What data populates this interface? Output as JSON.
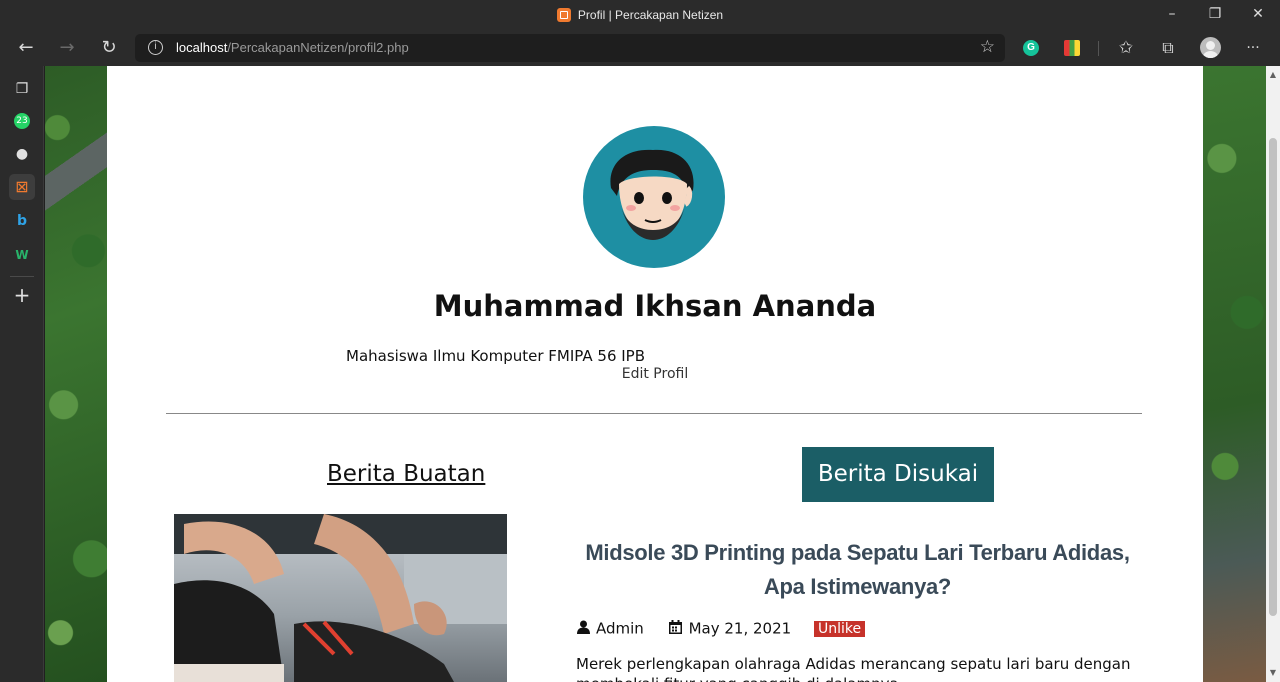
{
  "window": {
    "title": "Profil | Percakapan Netizen",
    "minimize_glyph": "–",
    "restore_glyph": "❐",
    "close_glyph": "✕"
  },
  "toolbar": {
    "back_glyph": "←",
    "forward_glyph": "→",
    "refresh_glyph": "↻",
    "address_host": "localhost",
    "address_path": "/PercakapanNetizen/profil2.php",
    "info_glyph": "i",
    "favorite_glyph": "☆",
    "grammarly_label": "G",
    "favorites_glyph": "✩",
    "collections_glyph": "⧉",
    "more_glyph": "···"
  },
  "sidebar": {
    "items": [
      {
        "name": "tabs-icon",
        "glyph": "❐"
      },
      {
        "name": "whatsapp-icon",
        "glyph": "23"
      },
      {
        "name": "github-icon",
        "glyph": "●"
      },
      {
        "name": "xampp-icon",
        "glyph": "⊠"
      },
      {
        "name": "bing-icon",
        "glyph": "b"
      },
      {
        "name": "w-icon",
        "glyph": "W"
      }
    ],
    "add_glyph": "+"
  },
  "profile": {
    "name": "Muhammad Ikhsan Ananda",
    "bio": "Mahasiswa Ilmu Komputer FMIPA 56 IPB",
    "edit_label": "Edit Profil"
  },
  "sections": {
    "created_label": "Berita Buatan",
    "liked_label": "Berita Disukai"
  },
  "article": {
    "title": "Midsole 3D Printing pada Sepatu Lari Terbaru Adidas, Apa Istimewanya?",
    "author": "Admin",
    "date": "May 21, 2021",
    "unlike_label": "Unlike",
    "excerpt": "Merek perlengkapan olahraga Adidas merancang sepatu lari baru dengan membekali fitur yang canggih di dalamnya."
  },
  "colors": {
    "accent_teal": "#1b5e66",
    "avatar_bg": "#1e8fa3",
    "unlike_red": "#c6322a",
    "title_slate": "#3a4a58"
  }
}
